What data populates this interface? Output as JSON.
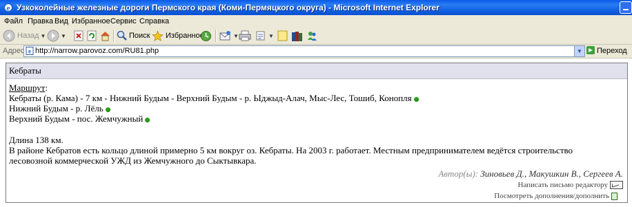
{
  "window": {
    "title": "Узкоколейные железные дороги Пермского края (Коми-Пермяцкого округа) - Microsoft Internet Explorer"
  },
  "menu": [
    "Файл",
    "Правка",
    "Вид",
    "Избранное",
    "Сервис",
    "Справка"
  ],
  "toolbar": {
    "back": "Назад",
    "search": "Поиск",
    "favorites": "Избранное"
  },
  "address": {
    "label": "Адрес:",
    "url": "http://narrow.parovoz.com/RU81.php",
    "go": "Переход"
  },
  "panel": {
    "title": "Кебраты",
    "route_label": "Маршрут",
    "route_colon": ":",
    "routes": [
      "Кебраты (р. Кама) - 7 км - Нижний Будым - Верхний Будым - р. Ыджыд-Алач, Мыс-Лес, Тошиб, Конопля",
      "Нижний Будым - р. Лёль",
      "Верхний Будым - пос. Жемчужный"
    ],
    "length": "Длина 138 км.",
    "description_line1": "В районе Кебратов есть кольцо длиной примерно 5 км вокруг оз. Кебраты. На 2003 г. работает. Местным предпринимателем ведётся строительство",
    "description_line2": "лесовозной коммерческой УЖД из Жемчужного до Сыктывкара.",
    "authors_label": "Автор(ы):",
    "authors": "Зиновьев Д., Макушкин В., Сергеев А.",
    "write_editor": "Написать письмо редактору",
    "view_additions": "Посмотреть дополнения/дополнить"
  }
}
